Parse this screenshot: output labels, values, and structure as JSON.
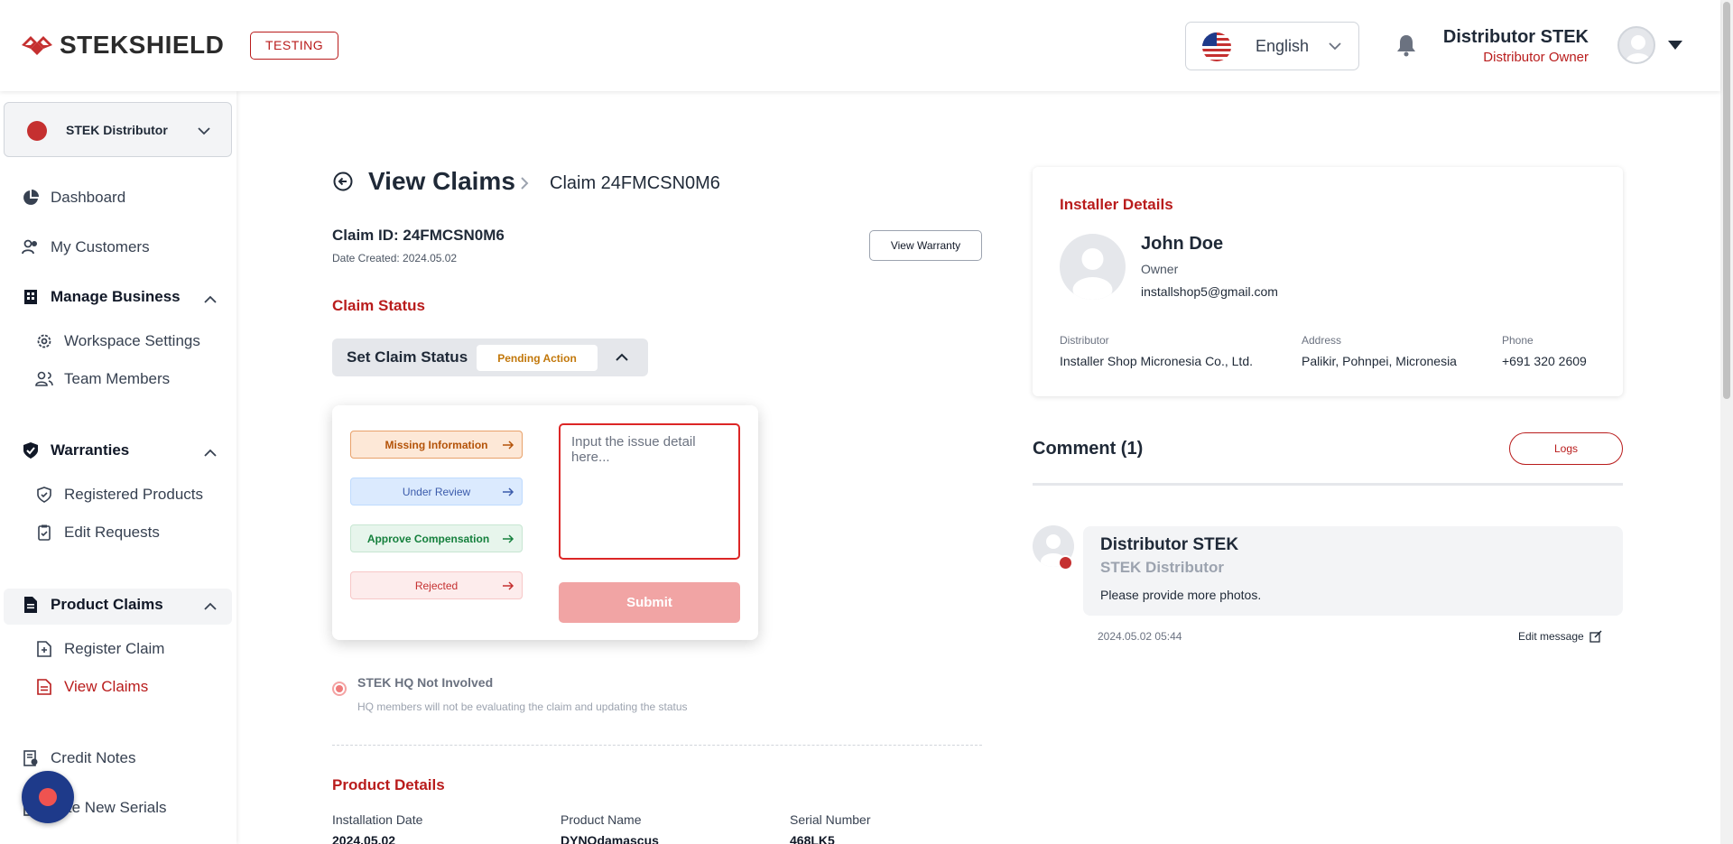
{
  "header": {
    "logo_text": "STEKSHIELD",
    "env_badge": "TESTING",
    "language": "English",
    "user_name": "Distributor STEK",
    "user_role": "Distributor Owner"
  },
  "sidebar": {
    "org_name": "STEK Distributor",
    "items": [
      {
        "label": "Dashboard",
        "icon": "pie-chart-icon"
      },
      {
        "label": "My Customers",
        "icon": "users-icon"
      },
      {
        "label": "Manage Business",
        "icon": "building-icon"
      },
      {
        "label": "Workspace Settings",
        "icon": "gear-icon"
      },
      {
        "label": "Team Members",
        "icon": "team-icon"
      },
      {
        "label": "Warranties",
        "icon": "shield-check-icon"
      },
      {
        "label": "Registered Products",
        "icon": "shield-icon"
      },
      {
        "label": "Edit Requests",
        "icon": "clipboard-check-icon"
      },
      {
        "label": "Product Claims",
        "icon": "document-icon"
      },
      {
        "label": "Register Claim",
        "icon": "file-plus-icon"
      },
      {
        "label": "View Claims",
        "icon": "file-list-icon"
      },
      {
        "label": "Credit Notes",
        "icon": "receipt-icon"
      },
      {
        "label": "eate New Serials",
        "icon": "serial-icon"
      }
    ]
  },
  "main": {
    "title": "View Claims",
    "breadcrumb": "Claim 24FMCSN0M6",
    "claim_id": "Claim ID: 24FMCSN0M6",
    "date_created": "Date Created: 2024.05.02",
    "view_warranty": "View Warranty",
    "claim_status_heading": "Claim Status",
    "set_status_label": "Set Claim Status",
    "current_status": "Pending Action",
    "status_options": [
      "Missing Information",
      "Under Review",
      "Approve Compensation",
      "Rejected"
    ],
    "issue_placeholder": "Input the issue detail here...",
    "submit": "Submit",
    "hq_title": "STEK HQ Not Involved",
    "hq_desc": "HQ members will not be evaluating the claim and updating the status",
    "product_details_heading": "Product Details",
    "product_details": {
      "labels": [
        "Installation Date",
        "Product Name",
        "Serial Number"
      ],
      "values": [
        "2024.05.02",
        "DYNOdamascus",
        "468LK5"
      ]
    }
  },
  "installer": {
    "heading": "Installer Details",
    "name": "John Doe",
    "role": "Owner",
    "email": "installshop5@gmail.com",
    "distributor_label": "Distributor",
    "distributor_value": "Installer Shop Micronesia Co., Ltd.",
    "address_label": "Address",
    "address_value": "Palikir, Pohnpei, Micronesia",
    "phone_label": "Phone",
    "phone_value": "+691 320 2609"
  },
  "comments": {
    "heading": "Comment (1)",
    "logs": "Logs",
    "items": [
      {
        "author": "Distributor STEK",
        "org": "STEK Distributor",
        "message": "Please provide more photos.",
        "time": "2024.05.02 05:44",
        "edit": "Edit message"
      }
    ]
  },
  "colors": {
    "brand": "#b91c1c",
    "pending": "#c2770a"
  }
}
